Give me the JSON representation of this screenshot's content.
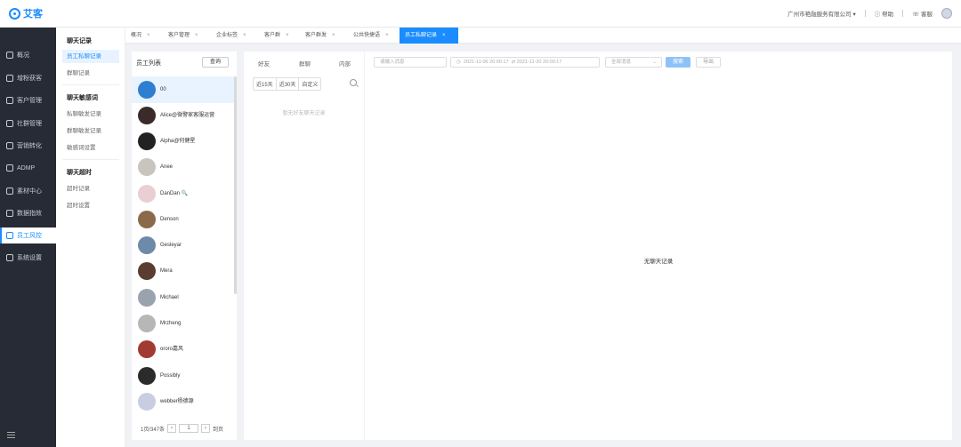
{
  "header": {
    "logo": "艾客",
    "company": "广州市艳融服务有限公司",
    "help": "帮助",
    "service": "客服"
  },
  "sidebar": {
    "items": [
      {
        "label": "概况",
        "icon": "home-icon"
      },
      {
        "label": "增粉获客",
        "icon": "user-add-icon"
      },
      {
        "label": "客户管理",
        "icon": "user-icon"
      },
      {
        "label": "社群管理",
        "icon": "group-icon"
      },
      {
        "label": "营销转化",
        "icon": "gift-icon"
      },
      {
        "label": "ADMP",
        "icon": "monitor-icon"
      },
      {
        "label": "素材中心",
        "icon": "folder-icon"
      },
      {
        "label": "数据指效",
        "icon": "chart-icon"
      },
      {
        "label": "员工风控",
        "icon": "shield-icon",
        "active": true
      },
      {
        "label": "系统设置",
        "icon": "gear-icon"
      }
    ]
  },
  "subnav": {
    "group1": "聊天记录",
    "item_private": "员工私聊记录",
    "item_group": "群聊记录",
    "group2": "聊天敏感词",
    "item_private_sensitive": "私聊敏发记录",
    "item_group_sensitive": "群聊敏发记录",
    "item_sensitive_settings": "敏感词设置",
    "group3": "聊天超时",
    "item_timeout_record": "超时记录",
    "item_timeout_settings": "超时设置"
  },
  "tabs": [
    {
      "label": "概况"
    },
    {
      "label": "客户管理"
    },
    {
      "label": "企业标签"
    },
    {
      "label": "客户群"
    },
    {
      "label": "客户群发"
    },
    {
      "label": "公共快捷语"
    },
    {
      "label": "员工私聊记录",
      "active": true
    }
  ],
  "employees": {
    "title": "员工列表",
    "query": "查询",
    "list": [
      {
        "name": "00",
        "color": "#2f7fd0"
      },
      {
        "name": "Alice@微警家客服运营",
        "color": "#3a2a2a"
      },
      {
        "name": "Alpha@何健星",
        "color": "#222222"
      },
      {
        "name": "Anee",
        "color": "#c9c4bd"
      },
      {
        "name": "DanDan 🔍",
        "color": "#e9cfd4"
      },
      {
        "name": "Denson",
        "color": "#8a6a4a"
      },
      {
        "name": "Gesleyar",
        "color": "#6d8aa8"
      },
      {
        "name": "Mera",
        "color": "#5a3c30"
      },
      {
        "name": "Michael",
        "color": "#9aa3ad"
      },
      {
        "name": "Mrzheng",
        "color": "#b7b7b7"
      },
      {
        "name": "ororo嘉风",
        "color": "#a03a32"
      },
      {
        "name": "Possibly",
        "color": "#2b2b2b"
      },
      {
        "name": "webber杨德源",
        "color": "#c8cde2"
      }
    ],
    "pager_text": "1页/347条",
    "page": "1",
    "goto": "到页"
  },
  "chat": {
    "tab_friend": "好友",
    "tab_group": "群聊",
    "tab_internal": "内部",
    "range_15": "近15天",
    "range_30": "近30天",
    "range_custom": "自定义",
    "empty": "暂无好友聊天记录"
  },
  "messages": {
    "search_placeholder": "请输入消息",
    "date_start": "2021-11-06 20:00:17",
    "date_end": "2021-11-20 20:00:17",
    "type_select": "全部消息",
    "search_btn": "搜索",
    "export_btn": "导出",
    "empty": "无聊天记录"
  },
  "colors": {
    "accent": "#1a8cff",
    "sidebar_bg": "#262b35"
  }
}
